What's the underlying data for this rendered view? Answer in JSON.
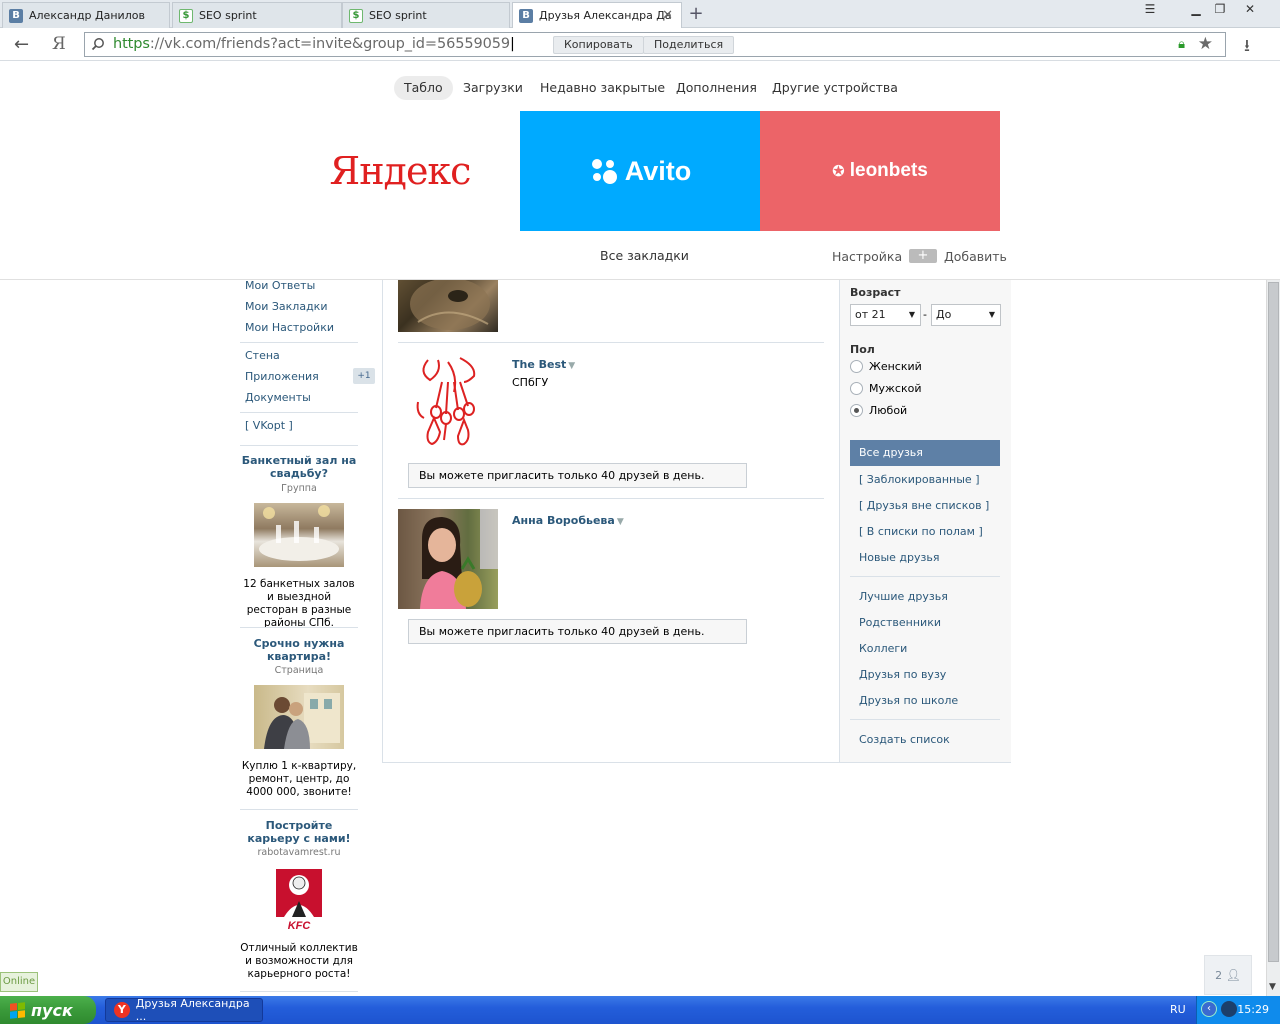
{
  "browser": {
    "tabs": [
      {
        "title": "Александр Данилов",
        "icon": "vk-favicon"
      },
      {
        "title": "SEO sprint",
        "icon": "seosprint-favicon"
      },
      {
        "title": "SEO sprint",
        "icon": "seosprint-favicon"
      },
      {
        "title": "Друзья Александра Да",
        "icon": "vk-favicon",
        "active": true
      }
    ],
    "new_tab": "+",
    "yandex_button": "Я",
    "url_protocol": "https",
    "url_rest": "://vk.com/friends?act=invite&group_id=56559059",
    "copy_button": "Копировать",
    "share_button": "Поделиться"
  },
  "bookmarks_panel": {
    "tabs": [
      "Табло",
      "Загрузки",
      "Недавно закрытые",
      "Дополнения",
      "Другие устройства"
    ],
    "active_tab": "Табло",
    "tiles": [
      {
        "name": "Яндекс",
        "color": "#ffffff",
        "text_color": "#e02020"
      },
      {
        "name": "Avito",
        "color": "#00aaff",
        "text_color": "#ffffff"
      },
      {
        "name": "leonbets",
        "color": "#ec6468",
        "text_color": "#ffffff"
      }
    ],
    "all_bookmarks": "Все закладки",
    "settings": "Настройка",
    "add": "Добавить"
  },
  "vk": {
    "left_menu": {
      "items_top": [
        "Мои Ответы",
        "Мои Закладки",
        "Мои Настройки"
      ],
      "items_bottom": [
        "Стена",
        "Приложения",
        "Документы"
      ],
      "apps_badge": "+1",
      "vkopt": "[ VKopt ]"
    },
    "ads": [
      {
        "title": "Банкетный зал на свадьбу?",
        "type": "Группа",
        "text": "12 банкетных залов и выездной ресторан в разные районы СПб."
      },
      {
        "title": "Срочно нужна квартира!",
        "type": "Страница",
        "text": "Куплю 1 к-квартиру, ремонт, центр, до 4000 000, звоните!"
      },
      {
        "title": "Постройте карьеру с нами!",
        "type": "rabotavamrest.ru",
        "text": "Отличный коллектив и возможности для карьерного роста!"
      }
    ],
    "friends": [
      {
        "name": "The Best",
        "sub": "СПбГУ",
        "notice": "Вы можете пригласить только 40 друзей в день."
      },
      {
        "name": "Анна Воробьева",
        "sub": "",
        "notice": "Вы можете пригласить только 40 друзей в день."
      }
    ],
    "filters": {
      "age_label": "Возраст",
      "age_from": "от 21",
      "age_to": "До",
      "age_dash": "-",
      "sex_label": "Пол",
      "sex_options": [
        "Женский",
        "Мужской",
        "Любой"
      ],
      "sex_selected": "Любой"
    },
    "lists": {
      "all_friends": "Все друзья",
      "group1": [
        "[ Заблокированные ]",
        "[ Друзья вне списков ]",
        "[ В списки по полам ]",
        "Новые друзья"
      ],
      "group2": [
        "Лучшие друзья",
        "Родственники",
        "Коллеги",
        "Друзья по вузу",
        "Друзья по школе"
      ],
      "create": "Создать список"
    },
    "online": "Online",
    "people_count": "2"
  },
  "taskbar": {
    "start": "пуск",
    "task": "Друзья Александра ...",
    "lang": "RU",
    "clock": "15:29"
  }
}
